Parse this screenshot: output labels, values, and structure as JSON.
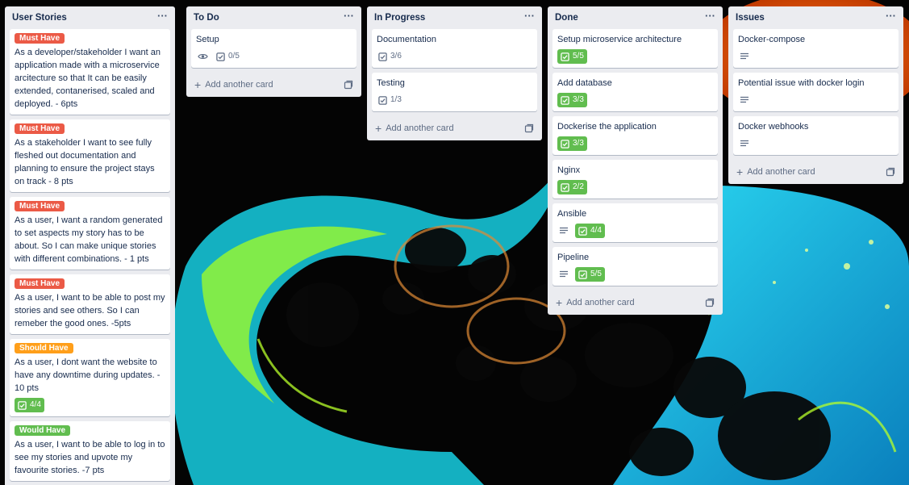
{
  "colors": {
    "must_have": "#eb5a46",
    "should_have": "#ff9f1a",
    "would_have": "#61bd4f",
    "checklist_done": "#61bd4f",
    "list_bg": "#ebecf0"
  },
  "common": {
    "menu_glyph": "···",
    "add_card_label": "Add another card"
  },
  "lists": [
    {
      "title": "User Stories",
      "cards": [
        {
          "label": "Must Have",
          "title": "As a developer/stakeholder I want an application made with a microservice arcitecture so that It can be easily extended, contanerised, scaled and deployed. - 6pts"
        },
        {
          "label": "Must Have",
          "title": "As a stakeholder I want to see fully fleshed out documentation and planning to ensure the project stays on track - 8 pts"
        },
        {
          "label": "Must Have",
          "title": "As a user, I want a random generated to set aspects my story has to be about. So I can make unique stories with different combinations. - 1 pts"
        },
        {
          "label": "Must Have",
          "title": "As a user, I want to be able to post my stories and see others. So I can remeber the good ones. -5pts"
        },
        {
          "label": "Should Have",
          "title": "As a user, I dont want the website to have any downtime during updates. - 10 pts",
          "checklist": "4/4"
        },
        {
          "label": "Would Have",
          "title": "As a user, I want to be able to log in to see my stories and upvote my favourite stories. -7 pts"
        }
      ]
    },
    {
      "title": "To Do",
      "cards": [
        {
          "title": "Setup",
          "checklist": "0/5",
          "watch_icon": "eye-icon"
        }
      ]
    },
    {
      "title": "In Progress",
      "cards": [
        {
          "title": "Documentation",
          "checklist": "3/6"
        },
        {
          "title": "Testing",
          "checklist": "1/3"
        }
      ]
    },
    {
      "title": "Done",
      "cards": [
        {
          "title": "Setup microservice architecture",
          "checklist": "5/5"
        },
        {
          "title": "Add database",
          "checklist": "3/3"
        },
        {
          "title": "Dockerise the application",
          "checklist": "3/3"
        },
        {
          "title": "Nginx",
          "checklist": "2/2"
        },
        {
          "title": "Ansible",
          "checklist": "4/4",
          "description_icon": "description-icon"
        },
        {
          "title": "Pipeline",
          "checklist": "5/5",
          "description_icon": "description-icon"
        }
      ]
    },
    {
      "title": "Issues",
      "cards": [
        {
          "title": "Docker-compose",
          "description_icon": "description-icon"
        },
        {
          "title": "Potential issue with docker login",
          "description_icon": "description-icon"
        },
        {
          "title": "Docker webhooks",
          "description_icon": "description-icon"
        }
      ]
    }
  ]
}
